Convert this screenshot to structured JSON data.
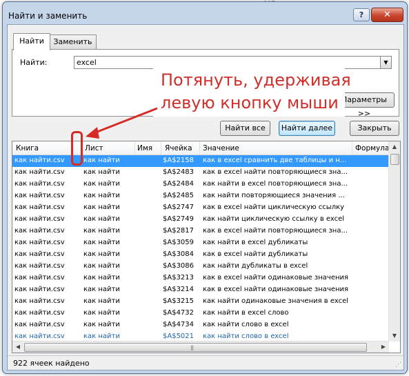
{
  "dialog": {
    "title": "Найти и заменить",
    "help_glyph": "?",
    "close_glyph": "✕"
  },
  "tabs": [
    {
      "label": "Найти",
      "active": true
    },
    {
      "label": "Заменить",
      "active": false
    }
  ],
  "find": {
    "label": "Найти:",
    "value": "excel"
  },
  "buttons": {
    "params": "Параметры >>",
    "find_all": "Найти все",
    "find_next": "Найти далее",
    "close": "Закрыть"
  },
  "results": {
    "columns": [
      "Книга",
      "Лист",
      "Имя",
      "Ячейка",
      "Значение",
      "Формула"
    ],
    "rows": [
      {
        "book": "как найти.csv",
        "sheet": "как найти",
        "cell": "$A$2158",
        "value": "как в excel сравнить две таблицы и н..."
      },
      {
        "book": "как найти.csv",
        "sheet": "как найти",
        "cell": "$A$2483",
        "value": "как в excel найти повторяющиеся зна..."
      },
      {
        "book": "как найти.csv",
        "sheet": "как найти",
        "cell": "$A$2484",
        "value": "как найти в excel повторяющиеся зна..."
      },
      {
        "book": "как найти.csv",
        "sheet": "как найти",
        "cell": "$A$2485",
        "value": "как найти повторяющиеся значения ..."
      },
      {
        "book": "как найти.csv",
        "sheet": "как найти",
        "cell": "$A$2747",
        "value": "как в excel найти циклическую ссылку"
      },
      {
        "book": "как найти.csv",
        "sheet": "как найти",
        "cell": "$A$2749",
        "value": "как найти циклическую ссылку в excel"
      },
      {
        "book": "как найти.csv",
        "sheet": "как найти",
        "cell": "$A$2817",
        "value": "как в excel найти повторяющиеся зна..."
      },
      {
        "book": "как найти.csv",
        "sheet": "как найти",
        "cell": "$A$3059",
        "value": "как найти в excel дубликаты"
      },
      {
        "book": "как найти.csv",
        "sheet": "как найти",
        "cell": "$A$3084",
        "value": "как в excel найти дубликаты"
      },
      {
        "book": "как найти.csv",
        "sheet": "как найти",
        "cell": "$A$3086",
        "value": "как найти дубликаты в excel"
      },
      {
        "book": "как найти.csv",
        "sheet": "как найти",
        "cell": "$A$3213",
        "value": "как в excel найти одинаковые значения"
      },
      {
        "book": "как найти.csv",
        "sheet": "как найти",
        "cell": "$A$3214",
        "value": "как в excel найти одинаковые значения"
      },
      {
        "book": "как найти.csv",
        "sheet": "как найти",
        "cell": "$A$3215",
        "value": "как найти одинаковые значения в excel"
      },
      {
        "book": "как найти.csv",
        "sheet": "как найти",
        "cell": "$A$4732",
        "value": "как найти в excel слово"
      },
      {
        "book": "как найти.csv",
        "sheet": "как найти",
        "cell": "$A$4734",
        "value": "как найти слово в excel"
      },
      {
        "book": "как найти.csv",
        "sheet": "как найти",
        "cell": "$A$5021",
        "value": "как найти слово в excel"
      }
    ]
  },
  "status": "922 ячеек найдено",
  "annotation": {
    "text": "Потянуть, удерживая левую кнопку мыши",
    "color": "#cf2f2a"
  },
  "colors": {
    "selection": "#3399ff",
    "close_button": "#c9452c"
  }
}
